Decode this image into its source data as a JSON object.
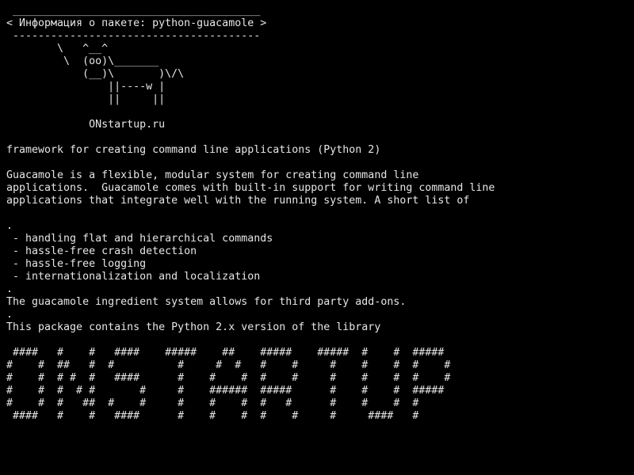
{
  "terminal": {
    "background": "#000000",
    "foreground": "#e6e6e6",
    "lines": [
      " _______________________________________",
      "< Информация о пакете: python-guacamole >",
      " ---------------------------------------",
      "        \\   ^__^",
      "         \\  (oo)\\_______",
      "            (__)\\       )\\/\\",
      "                ||----w |",
      "                ||     ||",
      "",
      "             ONstartup.ru",
      "",
      "framework for creating command line applications (Python 2)",
      "",
      "Guacamole is a flexible, modular system for creating command line",
      "applications.  Guacamole comes with built-in support for writing command line",
      "applications that integrate well with the running system. A short list of",
      "",
      ".",
      " - handling flat and hierarchical commands",
      " - hassle-free crash detection",
      " - hassle-free logging",
      " - internationalization and localization",
      ".",
      "The guacamole ingredient system allows for third party add-ons.",
      ".",
      "This package contains the Python 2.x version of the library",
      "",
      " ####   #    #   ####    #####    ##    #####    #####  #    #  #####",
      "#    #  ##   #  #          #     #  #   #    #     #    #    #  #    #",
      "#    #  # #  #   ####      #    #    #  #    #     #    #    #  #    #",
      "#    #  #  # #       #     #    ######  #####      #    #    #  #####",
      "#    #  #   ##  #    #     #    #    #  #   #      #    #    #  #",
      " ####   #    #   ####      #    #    #  #    #     #     ####   #"
    ]
  }
}
